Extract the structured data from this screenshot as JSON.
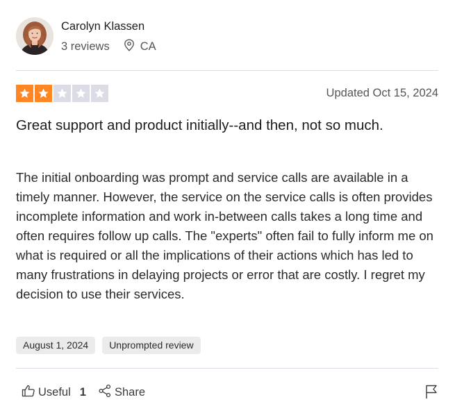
{
  "reviewer": {
    "name": "Carolyn Klassen",
    "reviews_count": "3 reviews",
    "location": "CA"
  },
  "review": {
    "rating": 2,
    "rating_max": 5,
    "updated": "Updated Oct 15, 2024",
    "title": "Great support and product initially--and then, not so much.",
    "body": "The initial onboarding was prompt and service calls are available in a timely manner. However, the service on the service calls is often provides incomplete information and work in-between calls takes a long time and often requires follow up calls. The \"experts\" often fail to fully inform me on what is required or all the implications of their actions which has led to many frustrations in delaying projects or error that are costly. I regret my decision to use their services.",
    "tags": [
      "August 1, 2024",
      "Unprompted review"
    ]
  },
  "actions": {
    "useful_label": "Useful",
    "useful_count": "1",
    "share_label": "Share"
  },
  "colors": {
    "star_filled": "#ff8622",
    "star_empty": "#dcdce6"
  },
  "icons": [
    "avatar-photo",
    "location-pin-icon",
    "star-icon",
    "thumbs-up-icon",
    "share-icon",
    "flag-icon"
  ]
}
